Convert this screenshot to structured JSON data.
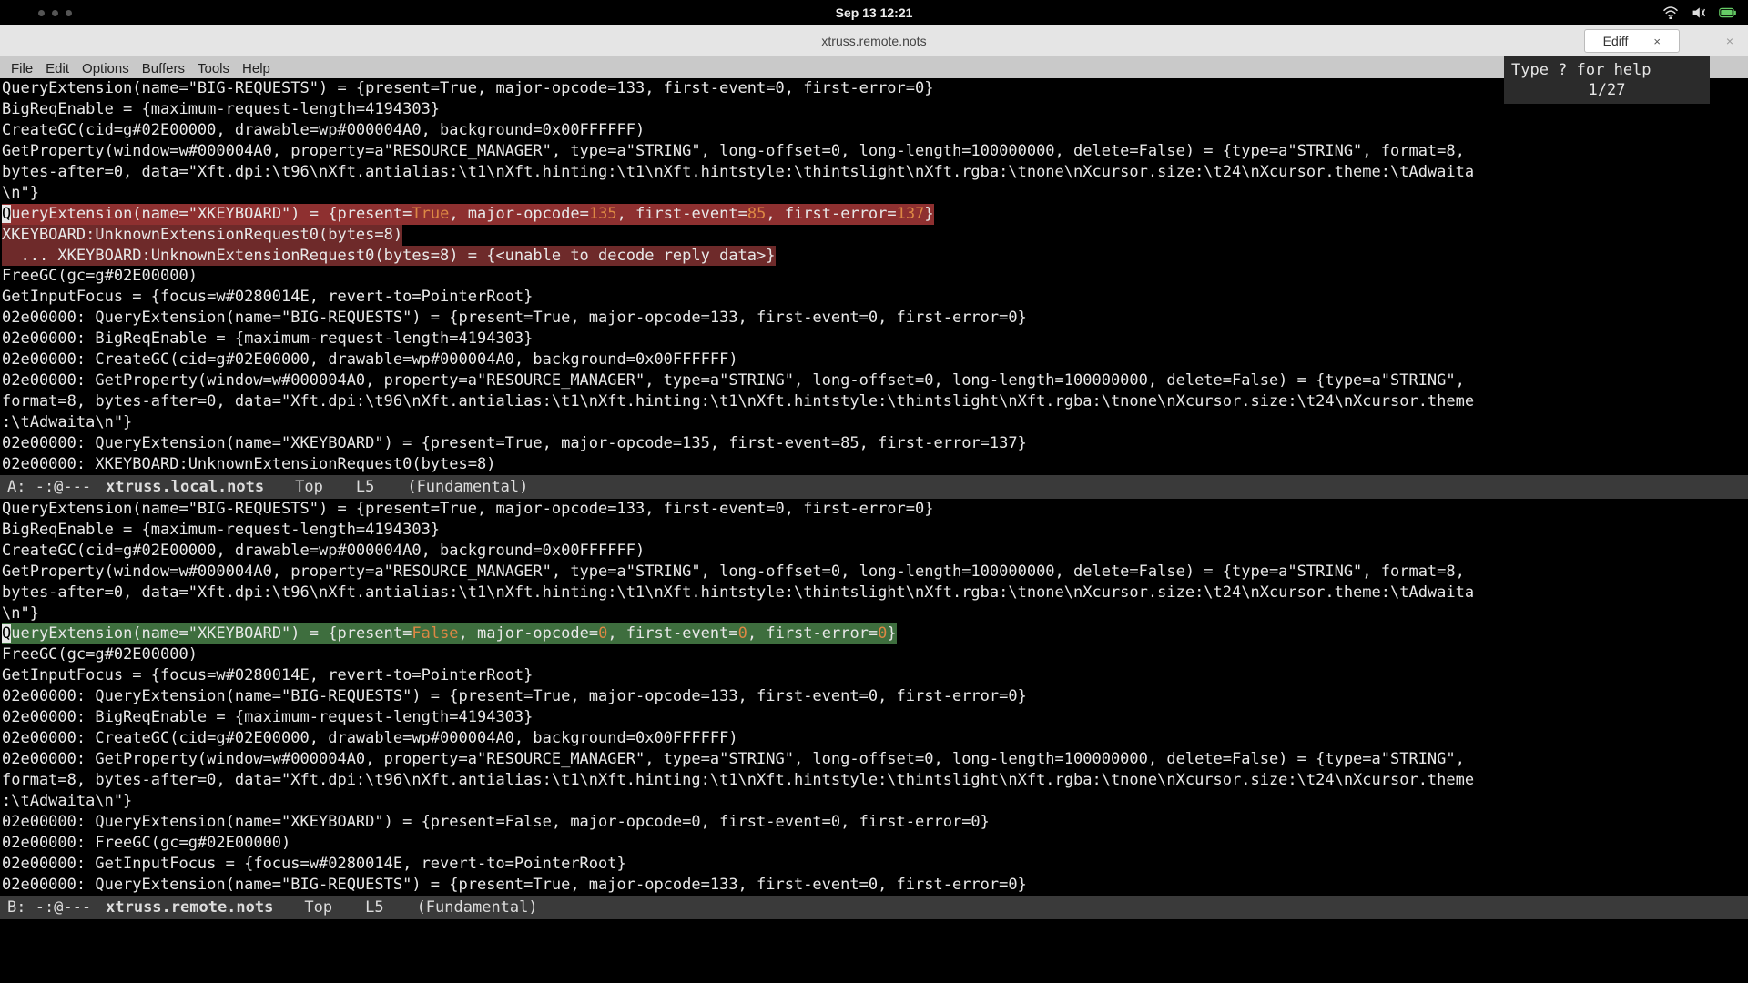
{
  "mac": {
    "clock": "Sep 13  12:21"
  },
  "window": {
    "title": "xtruss.remote.nots",
    "tab": "Ediff",
    "tab_close": "×",
    "win_close": "×"
  },
  "emacs_menu": [
    "File",
    "Edit",
    "Options",
    "Buffers",
    "Tools",
    "Help"
  ],
  "ediff": {
    "line1": "Type ? for help",
    "line2": "1/27"
  },
  "modeline_a": {
    "pre": " A:  -:@---  ",
    "file": "xtruss.local.nots",
    "pos": "Top",
    "line": "L5",
    "mode": "(Fundamental)"
  },
  "modeline_b": {
    "pre": " B:  -:@---  ",
    "file": "xtruss.remote.nots",
    "pos": "Top",
    "line": "L5",
    "mode": "(Fundamental)"
  },
  "a": {
    "l1": "QueryExtension(name=\"BIG-REQUESTS\") = {present=True, major-opcode=133, first-event=0, first-error=0}",
    "l2": "BigReqEnable = {maximum-request-length=4194303}",
    "l3": "CreateGC(cid=g#02E00000, drawable=wp#000004A0, background=0x00FFFFFF)",
    "l4": "GetProperty(window=w#000004A0, property=a\"RESOURCE_MANAGER\", type=a\"STRING\", long-offset=0, long-length=100000000, delete=False) = {type=a\"STRING\", format=8, ",
    "l4b": "bytes-after=0, data=\"Xft.dpi:\\t96\\nXft.antialias:\\t1\\nXft.hinting:\\t1\\nXft.hintstyle:\\thintslight\\nXft.rgba:\\tnone\\nXcursor.size:\\t24\\nXcursor.theme:\\tAdwaita",
    "l4c": "\\n\"}",
    "l5a": "Q",
    "l5b": "ueryExtension(name=\"XKEYBOARD\") = {present=",
    "l5c": "True",
    "l5d": ", major-opcode=",
    "l5e": "135",
    "l5f": ", first-event=",
    "l5g": "85",
    "l5h": ", first-error=",
    "l5i": "137",
    "l5j": "}",
    "l6": "XKEYBOARD:UnknownExtensionRequest0(bytes=8)",
    "l7": "  ... XKEYBOARD:UnknownExtensionRequest0(bytes=8) = {<unable to decode reply data>}",
    "l8": "FreeGC(gc=g#02E00000)",
    "l9": "GetInputFocus = {focus=w#0280014E, revert-to=PointerRoot}",
    "l10": "02e00000: QueryExtension(name=\"BIG-REQUESTS\") = {present=True, major-opcode=133, first-event=0, first-error=0}",
    "l11": "02e00000: BigReqEnable = {maximum-request-length=4194303}",
    "l12": "02e00000: CreateGC(cid=g#02E00000, drawable=wp#000004A0, background=0x00FFFFFF)",
    "l13": "02e00000: GetProperty(window=w#000004A0, property=a\"RESOURCE_MANAGER\", type=a\"STRING\", long-offset=0, long-length=100000000, delete=False) = {type=a\"STRING\", ",
    "l13b": "format=8, bytes-after=0, data=\"Xft.dpi:\\t96\\nXft.antialias:\\t1\\nXft.hinting:\\t1\\nXft.hintstyle:\\thintslight\\nXft.rgba:\\tnone\\nXcursor.size:\\t24\\nXcursor.theme",
    "l13c": ":\\tAdwaita\\n\"}",
    "l14": "02e00000: QueryExtension(name=\"XKEYBOARD\") = {present=True, major-opcode=135, first-event=85, first-error=137}",
    "l15": "02e00000: XKEYBOARD:UnknownExtensionRequest0(bytes=8)"
  },
  "b": {
    "l1": "QueryExtension(name=\"BIG-REQUESTS\") = {present=True, major-opcode=133, first-event=0, first-error=0}",
    "l2": "BigReqEnable = {maximum-request-length=4194303}",
    "l3": "CreateGC(cid=g#02E00000, drawable=wp#000004A0, background=0x00FFFFFF)",
    "l4": "GetProperty(window=w#000004A0, property=a\"RESOURCE_MANAGER\", type=a\"STRING\", long-offset=0, long-length=100000000, delete=False) = {type=a\"STRING\", format=8, ",
    "l4b": "bytes-after=0, data=\"Xft.dpi:\\t96\\nXft.antialias:\\t1\\nXft.hinting:\\t1\\nXft.hintstyle:\\thintslight\\nXft.rgba:\\tnone\\nXcursor.size:\\t24\\nXcursor.theme:\\tAdwaita",
    "l4c": "\\n\"}",
    "l5a": "Q",
    "l5b": "ueryExtension(name=\"XKEYBOARD\") = {present=",
    "l5c": "False",
    "l5d": ", major-opcode=",
    "l5e": "0",
    "l5f": ", first-event=",
    "l5g": "0",
    "l5h": ", first-error=",
    "l5i": "0",
    "l5j": "}",
    "l6": "FreeGC(gc=g#02E00000)",
    "l7": "GetInputFocus = {focus=w#0280014E, revert-to=PointerRoot}",
    "l8": "02e00000: QueryExtension(name=\"BIG-REQUESTS\") = {present=True, major-opcode=133, first-event=0, first-error=0}",
    "l9": "02e00000: BigReqEnable = {maximum-request-length=4194303}",
    "l10": "02e00000: CreateGC(cid=g#02E00000, drawable=wp#000004A0, background=0x00FFFFFF)",
    "l11": "02e00000: GetProperty(window=w#000004A0, property=a\"RESOURCE_MANAGER\", type=a\"STRING\", long-offset=0, long-length=100000000, delete=False) = {type=a\"STRING\", ",
    "l11b": "format=8, bytes-after=0, data=\"Xft.dpi:\\t96\\nXft.antialias:\\t1\\nXft.hinting:\\t1\\nXft.hintstyle:\\thintslight\\nXft.rgba:\\tnone\\nXcursor.size:\\t24\\nXcursor.theme",
    "l11c": ":\\tAdwaita\\n\"}",
    "l12": "02e00000: QueryExtension(name=\"XKEYBOARD\") = {present=False, major-opcode=0, first-event=0, first-error=0}",
    "l13": "02e00000: FreeGC(gc=g#02E00000)",
    "l14": "02e00000: GetInputFocus = {focus=w#0280014E, revert-to=PointerRoot}",
    "l15": "02e00000: QueryExtension(name=\"BIG-REQUESTS\") = {present=True, major-opcode=133, first-event=0, first-error=0}"
  }
}
